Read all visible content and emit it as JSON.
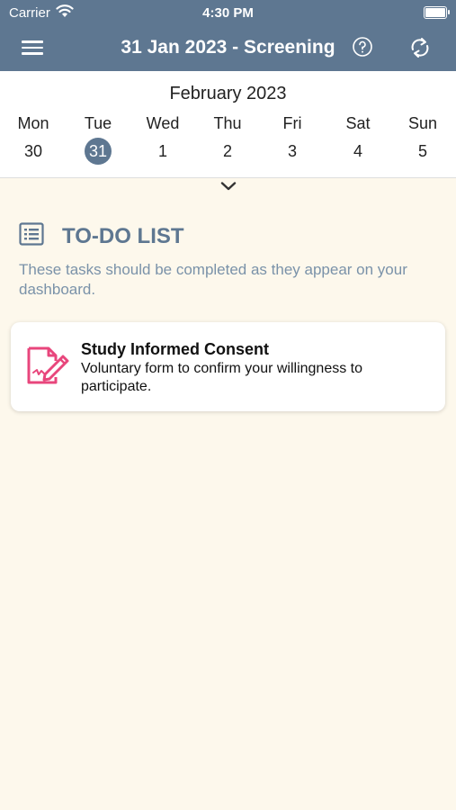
{
  "status_bar": {
    "carrier": "Carrier",
    "time": "4:30 PM"
  },
  "nav": {
    "title": "31 Jan 2023 - Screening",
    "menu_icon": "hamburger-menu-icon",
    "help_icon": "question-circle-icon",
    "refresh_icon": "refresh-icon"
  },
  "calendar": {
    "month": "February 2023",
    "days": [
      {
        "name": "Mon",
        "num": "30"
      },
      {
        "name": "Tue",
        "num": "31"
      },
      {
        "name": "Wed",
        "num": "1"
      },
      {
        "name": "Thu",
        "num": "2"
      },
      {
        "name": "Fri",
        "num": "3"
      },
      {
        "name": "Sat",
        "num": "4"
      },
      {
        "name": "Sun",
        "num": "5"
      }
    ],
    "selected_index": 1
  },
  "todo": {
    "title": "TO-DO LIST",
    "subtitle": "These tasks should be completed as they appear on your dashboard.",
    "items": [
      {
        "title": "Study Informed Consent",
        "description": "Voluntary form to confirm your willingness to participate."
      }
    ]
  },
  "colors": {
    "header": "#5e7791",
    "background": "#fdf8ec",
    "accent_pink": "#e8467c",
    "subtitle": "#7a92a9"
  }
}
